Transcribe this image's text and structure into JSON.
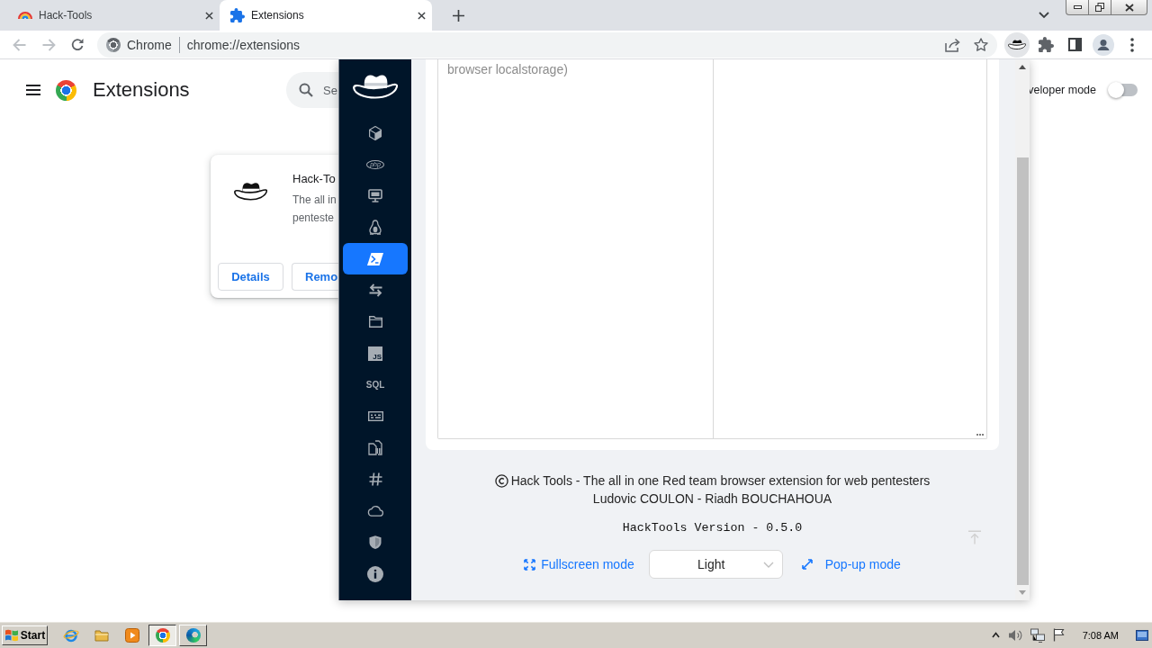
{
  "browser": {
    "tabs": [
      {
        "kind": "rainbow",
        "title": "Hack-Tools",
        "selected": false
      },
      {
        "kind": "puzzle",
        "title": "Extensions",
        "selected": true
      }
    ],
    "address_bar": {
      "site": "Chrome",
      "url": "chrome://extensions"
    },
    "toolbar_extensions": [
      {
        "kind": "hat",
        "selected": true
      },
      {
        "kind": "puzzle",
        "selected": false
      }
    ]
  },
  "page": {
    "title": "Extensions",
    "search": {
      "placeholder": "Se"
    },
    "developer_mode": {
      "label": "veloper mode",
      "on": false
    },
    "extension_card": {
      "name": "Hack-To",
      "description": [
        "The all in",
        "penteste"
      ],
      "buttons": [
        "Details",
        "Remo"
      ]
    }
  },
  "popup": {
    "menu": [
      {
        "kind": "cube",
        "selected": false
      },
      {
        "kind": "php",
        "text": "php",
        "selected": false
      },
      {
        "kind": "desktop",
        "selected": false
      },
      {
        "kind": "linux",
        "selected": false
      },
      {
        "kind": "terminal",
        "selected": true
      },
      {
        "kind": "swap",
        "selected": false
      },
      {
        "kind": "folder",
        "selected": false
      },
      {
        "kind": "js",
        "text": "JS",
        "selected": false
      },
      {
        "kind": "sql",
        "text": "SQL",
        "selected": false
      },
      {
        "kind": "form",
        "selected": false
      },
      {
        "kind": "file",
        "selected": false
      },
      {
        "kind": "hash",
        "selected": false
      },
      {
        "kind": "cloud",
        "selected": false
      },
      {
        "kind": "shield",
        "selected": false
      },
      {
        "kind": "info",
        "selected": false
      }
    ],
    "text_area": {
      "left_column": "browser localstorage)"
    },
    "footer": {
      "credit": "Hack Tools - The all in one Red team browser extension for web pentesters",
      "authors": "Ludovic COULON - Riadh BOUCHAHOUA",
      "version": "HackTools Version - 0.5.0",
      "fullscreen_link": "Fullscreen mode",
      "theme_select": {
        "value": "Light"
      },
      "popup_link": "Pop-up mode"
    }
  },
  "taskbar": {
    "start": "Start",
    "quick_launch": [
      {
        "kind": "ie"
      },
      {
        "kind": "folder"
      },
      {
        "kind": "media"
      }
    ],
    "windows": [
      {
        "kind": "chrome",
        "selected": true
      },
      {
        "kind": "edge",
        "selected": false
      }
    ],
    "clock": "7:08 AM"
  }
}
